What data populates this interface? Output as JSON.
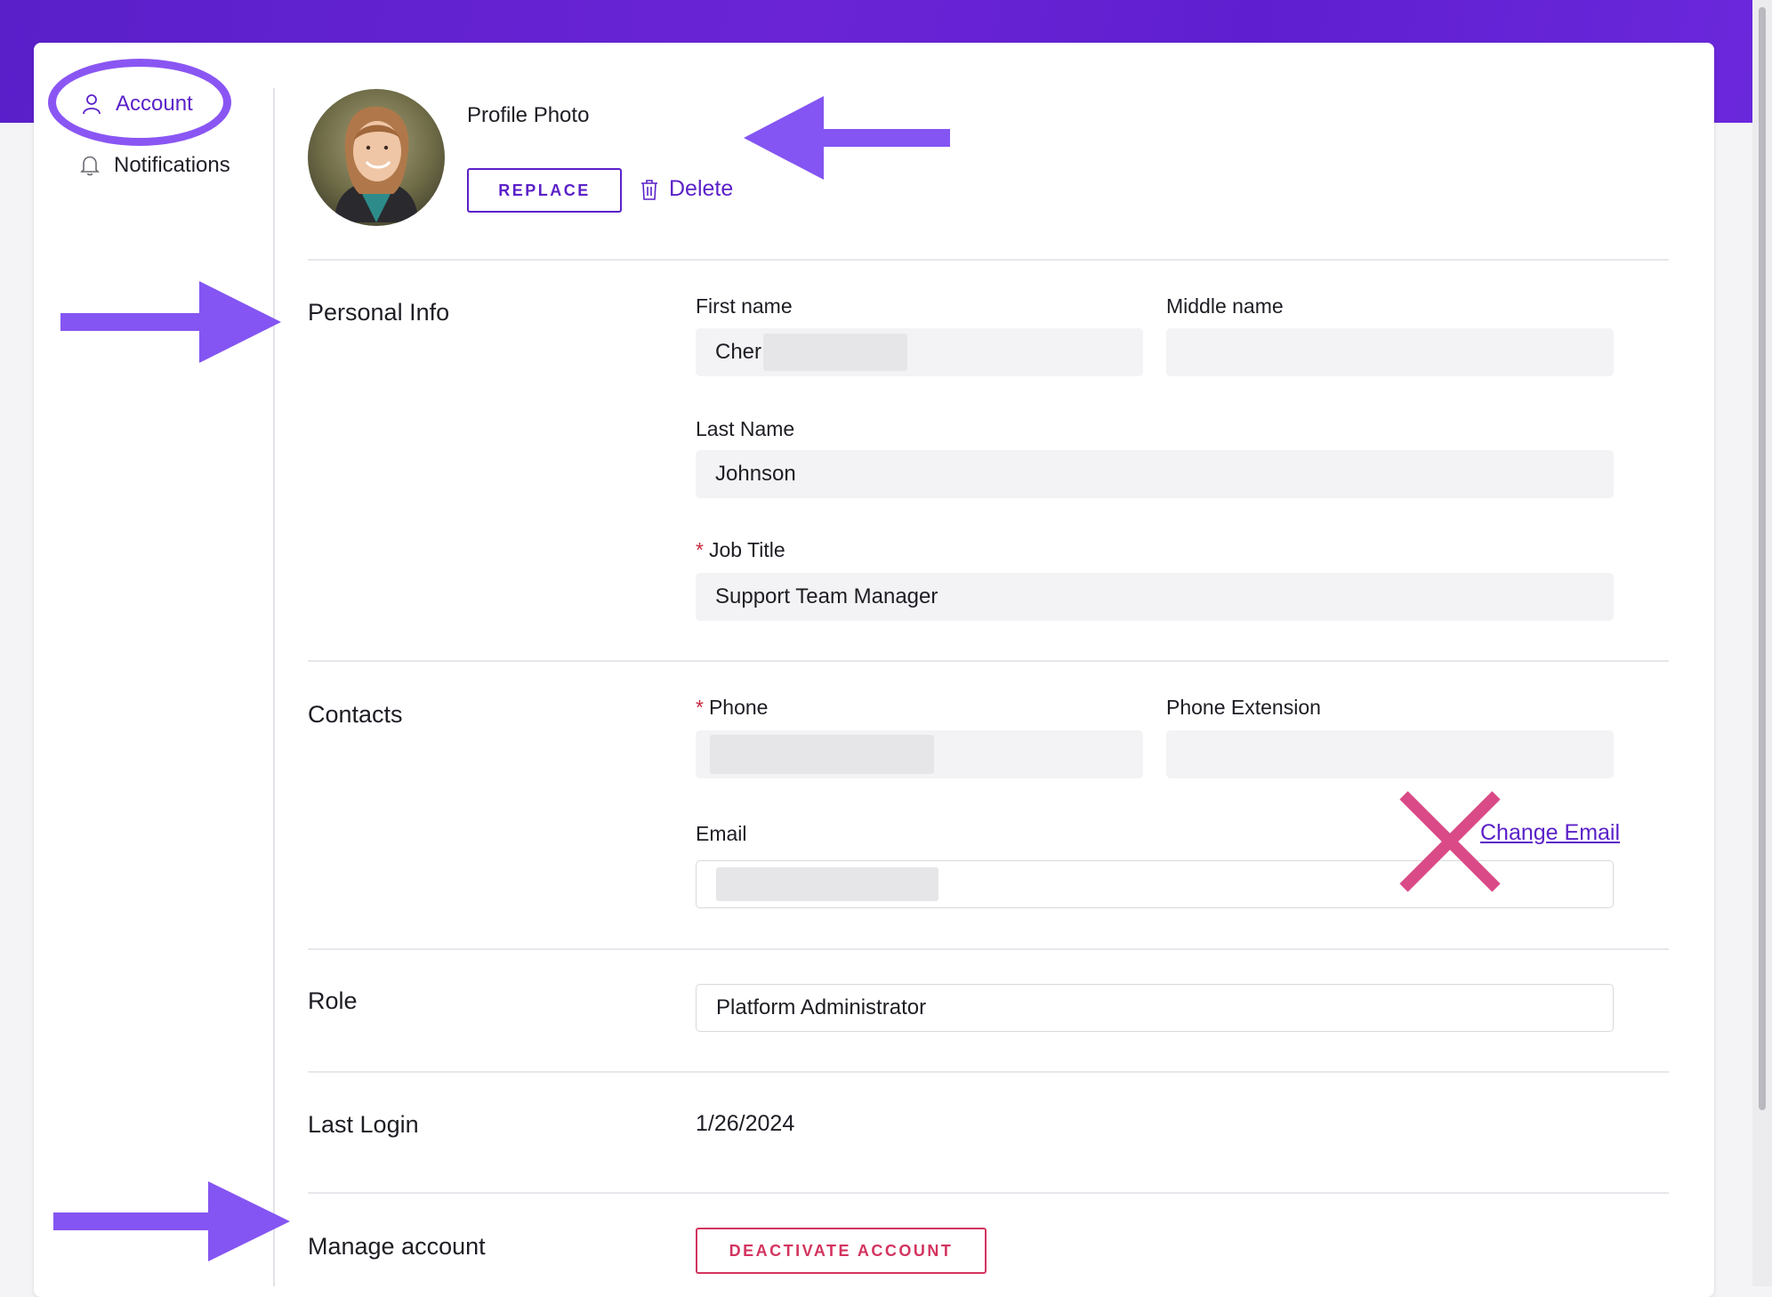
{
  "colors": {
    "accent": "#5b21c8",
    "header_band": "#6121d0",
    "annotation": "#8a56f3",
    "danger": "#d3345f",
    "required": "#c8283d",
    "cross_mark": "#d94a86"
  },
  "sidebar": {
    "items": [
      {
        "label": "Account",
        "icon": "user-icon",
        "active": true
      },
      {
        "label": "Notifications",
        "icon": "bell-icon",
        "active": false
      }
    ]
  },
  "profile_photo": {
    "label": "Profile Photo",
    "replace_label": "REPLACE",
    "delete_label": "Delete"
  },
  "personal_info": {
    "title": "Personal Info",
    "first_name": {
      "label": "First name",
      "value": "Cher"
    },
    "middle_name": {
      "label": "Middle name",
      "value": ""
    },
    "last_name": {
      "label": "Last Name",
      "value": "Johnson"
    },
    "job_title": {
      "label": "Job Title",
      "required_mark": "*",
      "value": "Support Team Manager"
    }
  },
  "contacts": {
    "title": "Contacts",
    "phone": {
      "label": "Phone",
      "required_mark": "*",
      "value": ""
    },
    "phone_extension": {
      "label": "Phone Extension",
      "value": ""
    },
    "email": {
      "label": "Email",
      "value": "",
      "change_label": "Change Email"
    }
  },
  "role": {
    "title": "Role",
    "value": "Platform Administrator"
  },
  "last_login": {
    "title": "Last Login",
    "value": "1/26/2024"
  },
  "manage_account": {
    "title": "Manage account",
    "deactivate_label": "DEACTIVATE ACCOUNT"
  }
}
